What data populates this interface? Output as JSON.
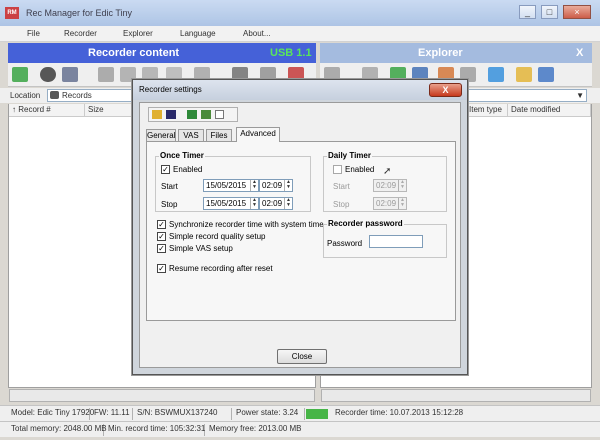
{
  "app": {
    "title": "Rec Manager for Edic Tiny",
    "icon_text": "RM"
  },
  "window_controls": {
    "minimize": "_",
    "maximize": "□",
    "close": "×"
  },
  "menu": [
    "File",
    "Recorder",
    "Explorer",
    "Language",
    "About..."
  ],
  "recorder_panel": {
    "title": "Recorder content",
    "usb": "USB 1.1"
  },
  "explorer_panel": {
    "title": "Explorer",
    "close": "X"
  },
  "location": {
    "label": "Location",
    "value": "Records"
  },
  "recorder_columns": [
    "↑ Record #",
    "Size"
  ],
  "explorer_columns": [
    "Item type",
    "Date modified"
  ],
  "status": {
    "model": "Model: Edic Tiny 17920",
    "fw": "FW: 11.11",
    "sn": "S/N: BSWMUX137240",
    "power": "Power state: 3.24",
    "recorder_time": "Recorder time: 10.07.2013 15:12:28",
    "total_memory": "Total memory: 2048.00 MB",
    "min_record": "Min. record time: 105:32:31",
    "memory_free": "Memory free: 2013.00 MB"
  },
  "dialog": {
    "title": "Recorder settings",
    "close_glyph": "X",
    "tabs": [
      "General",
      "VAS",
      "Files",
      "Advanced"
    ],
    "once_timer": {
      "title": "Once Timer",
      "enabled_label": "Enabled",
      "enabled": true,
      "start_label": "Start",
      "start_date": "15/05/2015",
      "start_time": "02:09",
      "stop_label": "Stop",
      "stop_date": "15/05/2015",
      "stop_time": "02:09"
    },
    "daily_timer": {
      "title": "Daily Timer",
      "enabled_label": "Enabled",
      "enabled": false,
      "start_label": "Start",
      "start_time": "02:09",
      "stop_label": "Stop",
      "stop_time": "02:09"
    },
    "options": [
      {
        "label": "Synchronize recorder time with system time",
        "checked": true
      },
      {
        "label": "Simple record quality setup",
        "checked": true
      },
      {
        "label": "Simple VAS setup",
        "checked": true
      }
    ],
    "resume": {
      "label": "Resume recording after reset",
      "checked": true
    },
    "password": {
      "title": "Recorder password",
      "label": "Password",
      "value": ""
    },
    "close_button": "Close"
  },
  "colors": {
    "recorder_head": "#1d3fd0",
    "explorer_head": "#90acd8",
    "usb_text": "#36e036",
    "accent_green": "#1fa51f"
  }
}
